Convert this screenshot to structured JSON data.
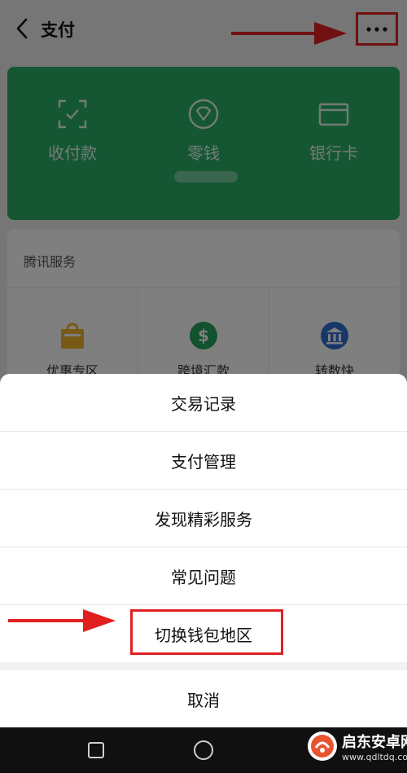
{
  "header": {
    "title": "支付",
    "back_icon": "chevron-left-icon",
    "more_icon": "more-horizontal-icon"
  },
  "wallet_card": {
    "items": [
      {
        "label": "收付款",
        "icon": "scan-icon"
      },
      {
        "label": "零钱",
        "icon": "diamond-coin-icon"
      },
      {
        "label": "银行卡",
        "icon": "bank-card-icon"
      }
    ],
    "color": "#2aae67"
  },
  "services": {
    "title": "腾讯服务",
    "items": [
      {
        "label": "优惠专区",
        "icon": "gift-bag-icon"
      },
      {
        "label": "跨境汇款",
        "icon": "dollar-exchange-icon"
      },
      {
        "label": "转数快",
        "icon": "bank-transfer-icon"
      }
    ]
  },
  "action_sheet": {
    "items": [
      "交易记录",
      "支付管理",
      "发现精彩服务",
      "常见问题",
      "切换钱包地区"
    ],
    "cancel": "取消"
  },
  "annotations": {
    "color": "#e02020"
  },
  "watermark": {
    "name": "启东安卓网",
    "url": "www.qdltdq.com"
  }
}
